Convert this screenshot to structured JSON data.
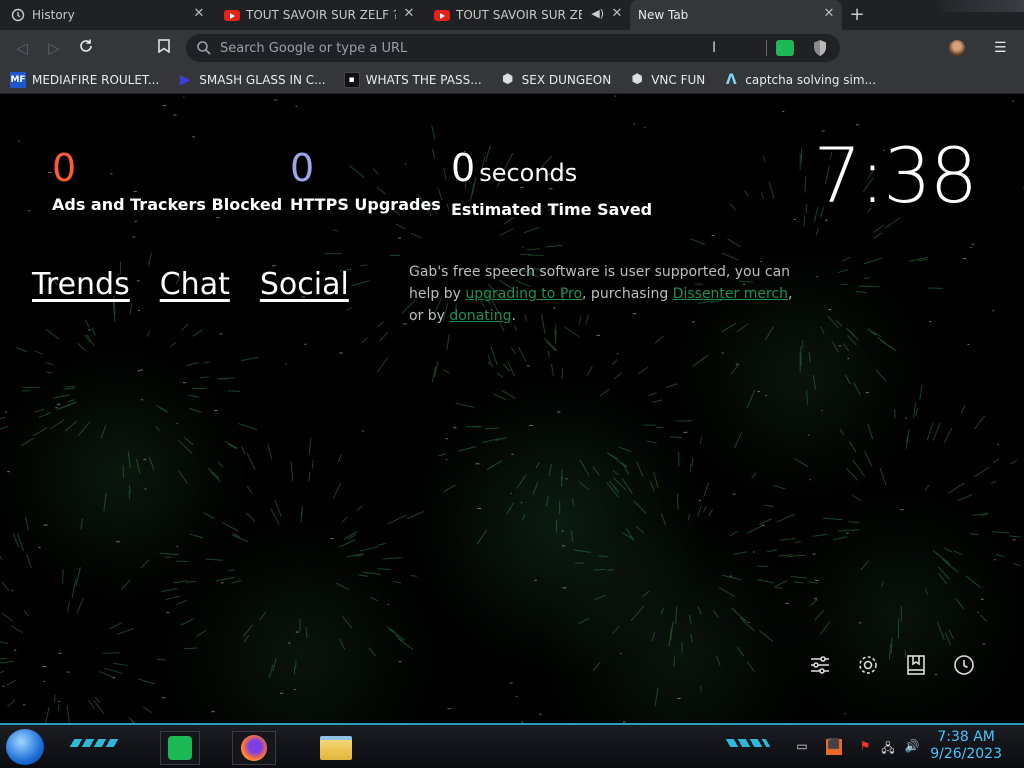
{
  "tabs": [
    {
      "title": "History",
      "icon": "history-icon"
    },
    {
      "title": "TOUT SAVOIR SUR ZELF ?! -",
      "icon": "youtube-icon"
    },
    {
      "title": "TOUT SAVOIR SUR ZELF",
      "icon": "youtube-icon"
    },
    {
      "title": "New Tab",
      "icon": ""
    }
  ],
  "omnibox": {
    "placeholder": "Search Google or type a URL"
  },
  "bookmarks": [
    {
      "label": "MEDIAFIRE ROULET...",
      "icon": "MF",
      "color": "#2156c9"
    },
    {
      "label": "SMASH GLASS IN C...",
      "icon": "▶",
      "color": "#3b3bd6"
    },
    {
      "label": "WHATS THE PASS...",
      "icon": "▪",
      "color": "#111111"
    },
    {
      "label": "SEX DUNGEON",
      "icon": "⬢",
      "color": "#dddddd"
    },
    {
      "label": "VNC FUN",
      "icon": "⬢",
      "color": "#dddddd"
    },
    {
      "label": "captcha solving sim...",
      "icon": "Λ",
      "color": "#7fd3f5"
    }
  ],
  "stats": {
    "ads_count": "0",
    "ads_label": "Ads and Trackers Blocked",
    "https_count": "0",
    "https_label": "HTTPS Upgrades",
    "time_count": "0",
    "time_unit": "seconds",
    "time_label": "Estimated Time Saved"
  },
  "colors": {
    "ads": "#ff5b3a",
    "https": "#a0a5eb",
    "gab_link": "#1f8f4e",
    "taskbar_accent": "#2a9db8"
  },
  "clock": "7:38",
  "links": {
    "trends": "Trends",
    "chat": "Chat",
    "social": "Social"
  },
  "gab": {
    "t1": "Gab's free speech software is user supported, you can help by ",
    "l1": "upgrading to Pro",
    "t2": ", purchasing ",
    "l2": "Dissenter merch",
    "t3": ", or by ",
    "l3": "donating",
    "t4": "."
  },
  "taskbar": {
    "time": "7:38 AM",
    "date": "9/26/2023"
  }
}
